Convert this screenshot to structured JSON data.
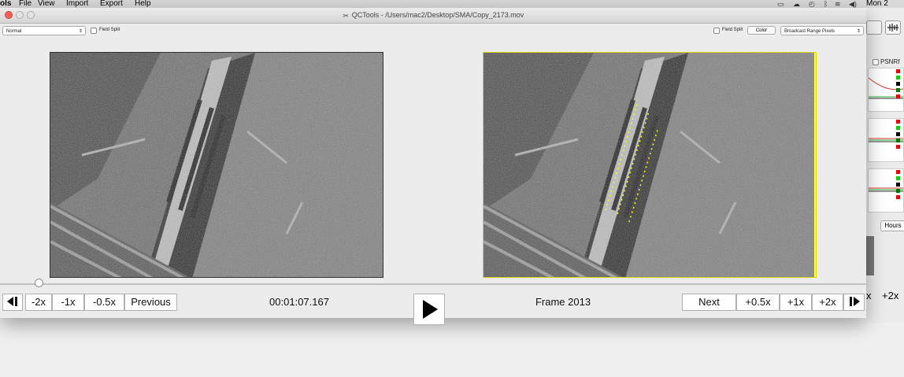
{
  "menubar": {
    "app_name": "ols",
    "items": [
      "File",
      "View",
      "Import",
      "Export",
      "Help"
    ],
    "clock": "Mon 2"
  },
  "window": {
    "title": "QCTools - /Users/mac2/Desktop/SMA/Copy_2173.mov"
  },
  "left_panel": {
    "mode_value": "Normal",
    "field_split_label": "Field Split"
  },
  "right_panel": {
    "field_split_label": "Field Split",
    "color_button": "Color",
    "filter_value": "Broadcast Range Pixels"
  },
  "background_app": {
    "psnr_label": "PSNRf",
    "hours_button": "Hours",
    "x_label": "x",
    "plus2x_label": "+2x"
  },
  "playback": {
    "progress": 0.04,
    "timecode": "00:01:07.167",
    "frame_label": "Frame 2013",
    "left_buttons": [
      "-2x",
      "-1x",
      "-0.5x",
      "Previous"
    ],
    "right_buttons": [
      "Next",
      "+0.5x",
      "+1x",
      "+2x"
    ]
  },
  "colors": {
    "highlight": "#ffff00",
    "window_bg": "#ececec"
  }
}
